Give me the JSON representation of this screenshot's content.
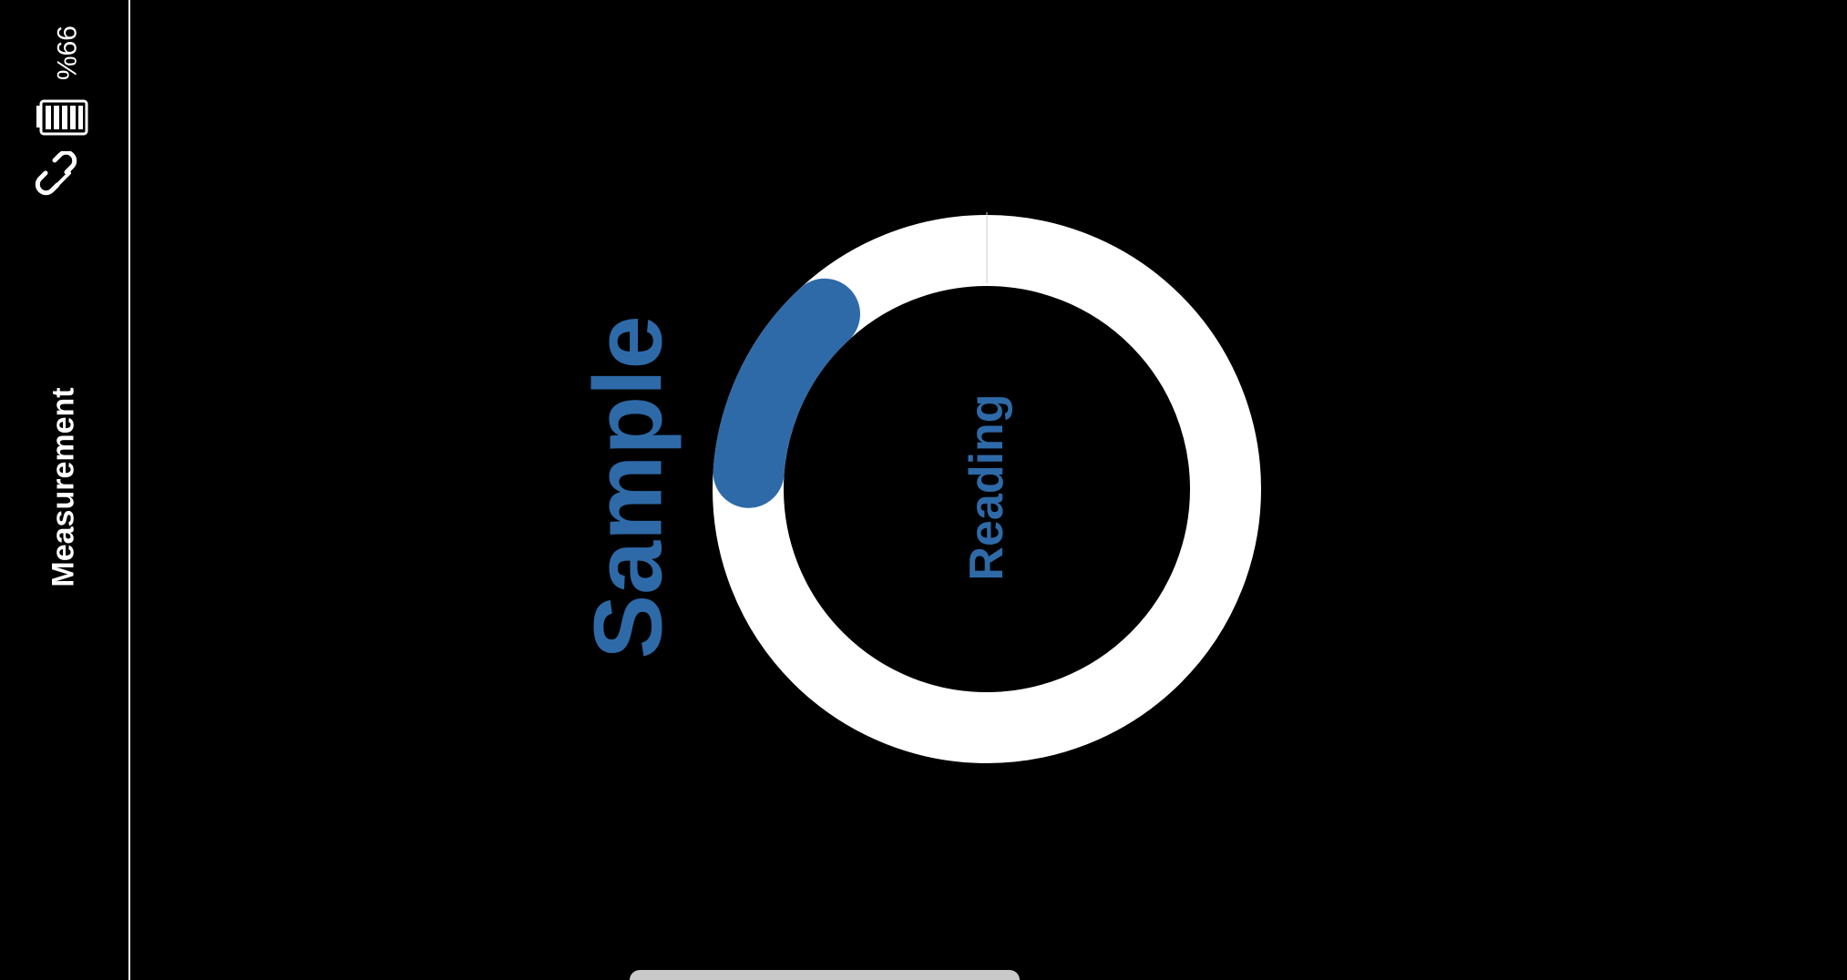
{
  "status": {
    "battery_percent_text": "99%",
    "battery_icon": "battery-full-icon",
    "connection_icon": "link-icon"
  },
  "sidebar": {
    "title": "Measurement"
  },
  "gauge": {
    "progress_fraction": 0.12,
    "sample_label": "Sample",
    "reading_label": "Reading",
    "progress_color": "#2e6aa8",
    "track_color": "#ffffff"
  },
  "colors": {
    "background": "#000000",
    "foreground": "#ffffff",
    "accent": "#2e6aa8"
  }
}
